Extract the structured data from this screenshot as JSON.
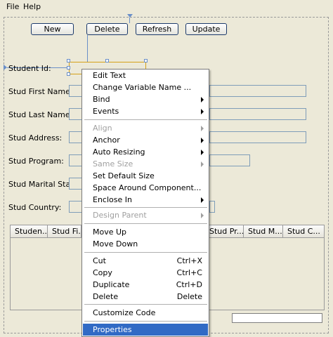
{
  "menubar": {
    "file": "File",
    "help": "Help"
  },
  "buttons": {
    "new": "New",
    "delete": "Delete",
    "refresh": "Refresh",
    "update": "Update"
  },
  "labels": {
    "student_id": "Student Id:",
    "first_name": "Stud First Name:",
    "last_name": "Stud Last Name:",
    "address": "Stud Address:",
    "program": "Stud Program:",
    "marital": "Stud Marital Status:",
    "country": "Stud Country:"
  },
  "table": {
    "columns": [
      "Studen...",
      "Stud Fi...",
      "Stud Pr...",
      "Stud M...",
      "Stud C..."
    ]
  },
  "context_menu": {
    "edit_text": "Edit Text",
    "change_variable_name": "Change Variable Name ...",
    "bind": "Bind",
    "events": "Events",
    "align": "Align",
    "anchor": "Anchor",
    "auto_resizing": "Auto Resizing",
    "same_size": "Same Size",
    "set_default_size": "Set Default Size",
    "space_around": "Space Around Component...",
    "enclose_in": "Enclose In",
    "design_parent": "Design Parent",
    "move_up": "Move Up",
    "move_down": "Move Down",
    "cut": "Cut",
    "cut_sc": "Ctrl+X",
    "copy": "Copy",
    "copy_sc": "Ctrl+C",
    "duplicate": "Duplicate",
    "duplicate_sc": "Ctrl+D",
    "delete": "Delete",
    "delete_sc": "Delete",
    "customize_code": "Customize Code",
    "properties": "Properties"
  },
  "colors": {
    "selection": "#316ac5",
    "border": "#7f9db9",
    "background": "#ece9d8"
  }
}
